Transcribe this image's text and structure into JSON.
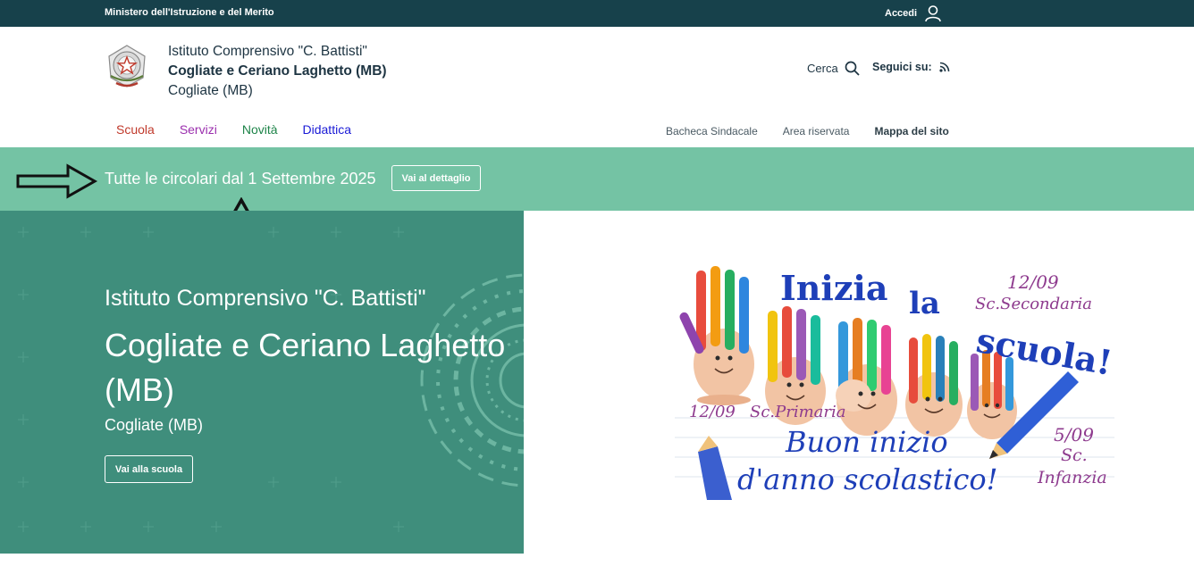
{
  "topbar": {
    "ministry": "Ministero dell'Istruzione e del Merito",
    "login_label": "Accedi"
  },
  "header": {
    "school_line1": "Istituto Comprensivo \"C. Battisti\"",
    "school_line2": "Cogliate e Ceriano Laghetto (MB)",
    "school_line3": "Cogliate (MB)",
    "search_label": "Cerca",
    "follow_label": "Seguici su:"
  },
  "main_nav": {
    "items": [
      {
        "label": "Scuola",
        "color": "#c0392b"
      },
      {
        "label": "Servizi",
        "color": "#9b2fae"
      },
      {
        "label": "Novità",
        "color": "#1e8449"
      },
      {
        "label": "Didattica",
        "color": "#1a1ad6"
      }
    ]
  },
  "secondary_nav": {
    "items": [
      "Bacheca Sindacale",
      "Area riservata",
      "Mappa del sito"
    ]
  },
  "notice": {
    "message": "Tutte le circolari dal 1 Settembre 2025",
    "button_label": "Vai al dettaglio"
  },
  "hero": {
    "line1": "Istituto Comprensivo \"C. Battisti\"",
    "line2": "Cogliate e Ceriano Laghetto (MB)",
    "line3": "Cogliate (MB)",
    "button_label": "Vai alla scuola"
  },
  "poster": {
    "headline_1": "Inizia",
    "headline_2": "la",
    "headline_3": "scuola!",
    "secondary_date": "12/09",
    "secondary_label": "Sc.Secondaria",
    "primary_date": "12/09",
    "primary_label": "Sc.Primaria",
    "greeting_1": "Buon inizio",
    "greeting_2": "d'anno scolastico!",
    "infancy_date": "5/09",
    "infancy_label_1": "Sc.",
    "infancy_label_2": "Infanzia"
  },
  "colors": {
    "topbar": "#17414b",
    "notice_band": "#74c3a4",
    "hero": "#3f8e7c"
  }
}
